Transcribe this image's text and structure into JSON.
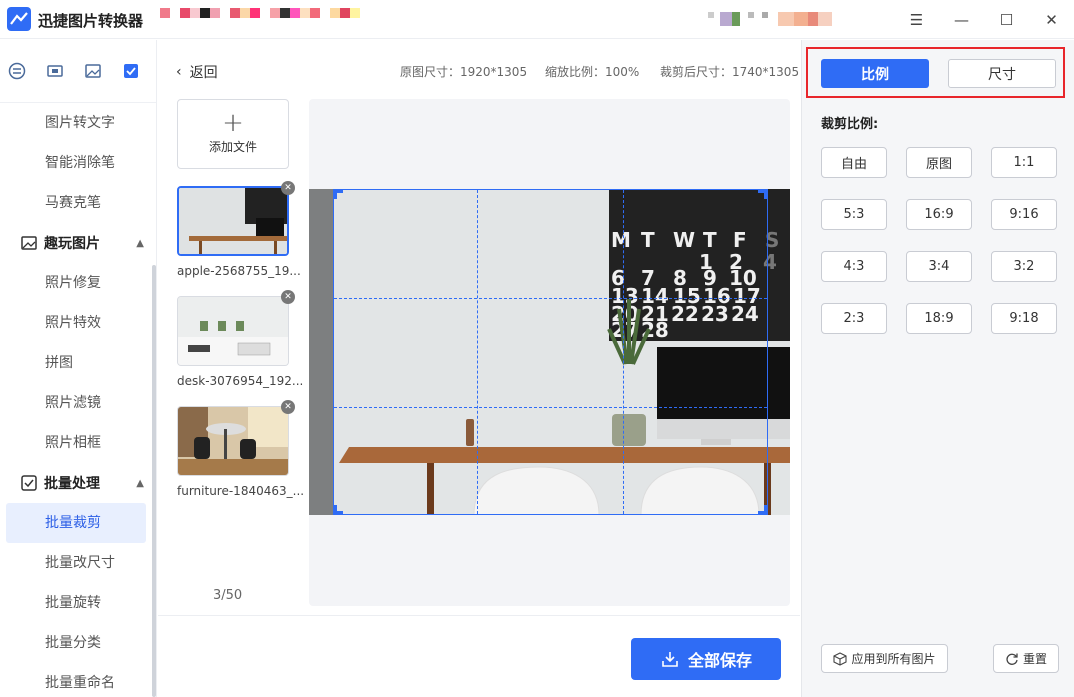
{
  "app": {
    "title": "迅捷图片转换器"
  },
  "window": {
    "menu_icon": "menu-icon",
    "minimize_icon": "minimize-icon",
    "maximize_icon": "maximize-icon",
    "close_icon": "close-icon"
  },
  "sidebar": {
    "items_top": [
      "图片转文字",
      "智能消除笔",
      "马赛克笔"
    ],
    "group_fun": {
      "label": "趣玩图片",
      "items": [
        "照片修复",
        "照片特效",
        "拼图",
        "照片滤镜",
        "照片相框"
      ]
    },
    "group_batch": {
      "label": "批量处理",
      "items": [
        "批量裁剪",
        "批量改尺寸",
        "批量旋转",
        "批量分类",
        "批量重命名"
      ]
    }
  },
  "topbar": {
    "back": "返回",
    "original_size": "原图尺寸：1920*1305",
    "zoom": "缩放比例：100%",
    "cropped_size": "裁剪后尺寸：1740*1305"
  },
  "files": {
    "add_label": "添加文件",
    "items": [
      {
        "name": "apple-2568755_19..."
      },
      {
        "name": "desk-3076954_192..."
      },
      {
        "name": "furniture-1840463_..."
      }
    ],
    "counter": "3/50"
  },
  "save_button": "全部保存",
  "right_panel": {
    "tab_ratio": "比例",
    "tab_size": "尺寸",
    "crop_ratio_label": "裁剪比例:",
    "ratios": [
      "自由",
      "原图",
      "1:1",
      "5:3",
      "16:9",
      "9:16",
      "4:3",
      "3:4",
      "3:2",
      "2:3",
      "18:9",
      "9:18"
    ],
    "apply_all": "应用到所有图片",
    "reset": "重置"
  },
  "colors": {
    "accent": "#2f6cf5",
    "highlight_border": "#e8262b"
  }
}
